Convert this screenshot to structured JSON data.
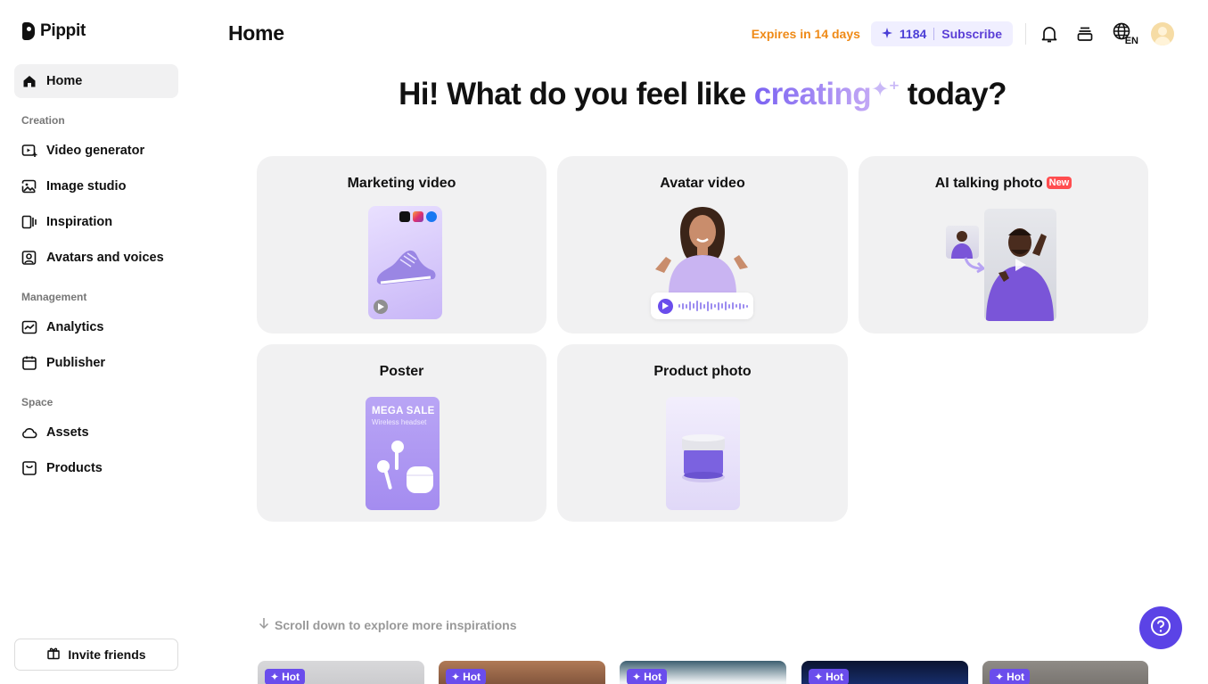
{
  "app": {
    "name": "Pippit"
  },
  "sidebar": {
    "items": [
      {
        "label": "Home",
        "icon": "home-icon"
      }
    ],
    "sections": [
      {
        "title": "Creation",
        "items": [
          {
            "label": "Video generator",
            "icon": "video-generator-icon"
          },
          {
            "label": "Image studio",
            "icon": "image-studio-icon"
          },
          {
            "label": "Inspiration",
            "icon": "inspiration-icon"
          },
          {
            "label": "Avatars and voices",
            "icon": "avatar-icon"
          }
        ]
      },
      {
        "title": "Management",
        "items": [
          {
            "label": "Analytics",
            "icon": "analytics-icon"
          },
          {
            "label": "Publisher",
            "icon": "calendar-icon"
          }
        ]
      },
      {
        "title": "Space",
        "items": [
          {
            "label": "Assets",
            "icon": "cloud-icon"
          },
          {
            "label": "Products",
            "icon": "bag-icon"
          }
        ]
      }
    ],
    "invite_label": "Invite friends"
  },
  "header": {
    "title": "Home",
    "expires": "Expires in 14 days",
    "credits": "1184",
    "subscribe": "Subscribe",
    "lang": "EN"
  },
  "hero": {
    "pre": "Hi! What do you feel like ",
    "highlight": "creating",
    "post": " today?"
  },
  "cards": {
    "marketing": {
      "title": "Marketing video"
    },
    "avatar": {
      "title": "Avatar video"
    },
    "talking": {
      "title": "AI talking photo",
      "badge": "New"
    },
    "poster": {
      "title": "Poster",
      "headline": "MEGA SALE",
      "sub": "Wireless headset"
    },
    "product": {
      "title": "Product photo"
    }
  },
  "scroll_hint": "Scroll down to explore more inspirations",
  "inspirations": [
    {
      "badge": "Hot"
    },
    {
      "badge": "Hot"
    },
    {
      "badge": "Hot"
    },
    {
      "badge": "Hot"
    },
    {
      "badge": "Hot"
    }
  ],
  "colors": {
    "accent": "#5b43e6",
    "expires": "#ef8a17",
    "new_badge": "#ff4d4f"
  }
}
